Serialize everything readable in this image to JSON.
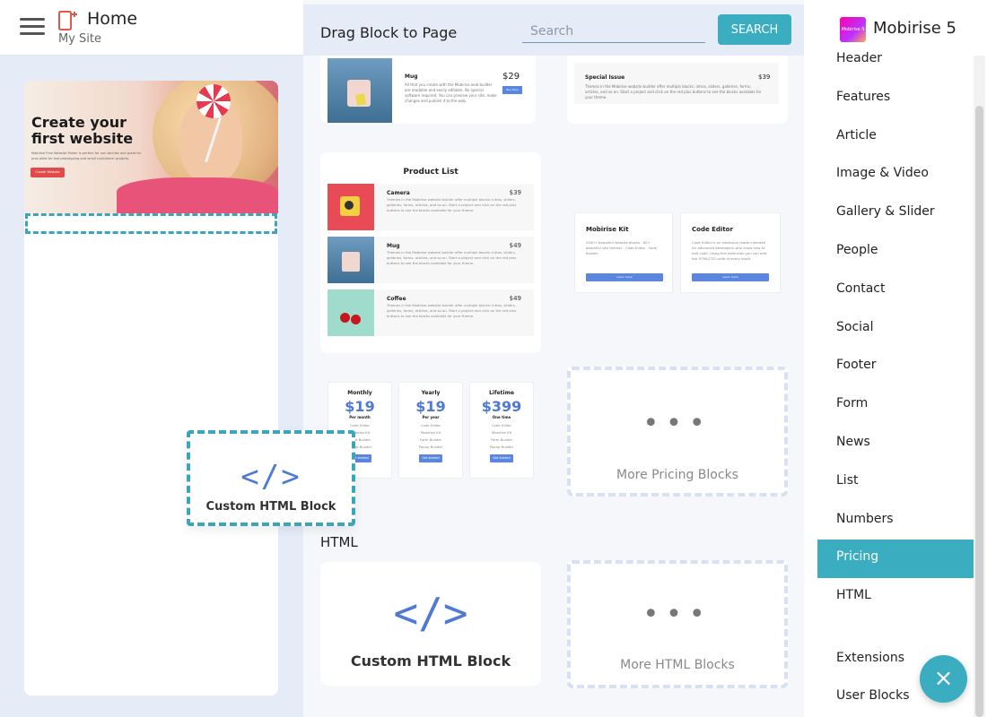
{
  "header": {
    "home_title": "Home",
    "site_subtitle": "My Site"
  },
  "preview": {
    "hero_title": "Create your first website",
    "hero_text": "Mobirise Free Website Maker is perfect for non-techies and great for pros alike for fast prototyping and small customers' projects.",
    "hero_button": "Create Website"
  },
  "drag_ghost": {
    "code_glyph": "</>",
    "label": "Custom HTML Block"
  },
  "blocks": {
    "title": "Drag Block to Page",
    "search_placeholder": "Search",
    "search_button": "SEARCH",
    "mug_card": {
      "name": "Mug",
      "price": "$29",
      "desc": "All that you create with the Mobirise web builder are readable and easily editable. No special software required. You can preview your site, make changes and publish it to the web.",
      "button": "Buy Now"
    },
    "special_issue": {
      "name": "Special Issue",
      "price": "$39",
      "desc": "Themes in the Mobirise website builder offer multiple blocks: intros, sliders, galleries, forms, articles, and so on. Start a project and click on the red plus buttons to see the blocks available for your theme."
    },
    "product_list": {
      "title": "Product List",
      "items": [
        {
          "name": "Camera",
          "price": "$39",
          "desc": "Themes in the Mobirise website builder offer multiple blocks: intros, sliders, galleries, forms, articles, and so on. Start a project and click on the red plus buttons to see the blocks available for your theme."
        },
        {
          "name": "Mug",
          "price": "$49",
          "desc": "Themes in the Mobirise website builder offer multiple blocks: intros, sliders, galleries, forms, articles, and so on. Start a project and click on the red plus buttons to see the blocks available for your theme."
        },
        {
          "name": "Coffee",
          "price": "$49",
          "desc": "Themes in the Mobirise website builder offer multiple blocks: intros, sliders, galleries, forms, articles, and so on. Start a project and click on the red plus buttons to see the blocks available for your theme."
        }
      ]
    },
    "kit_cards": [
      {
        "title": "Mobirise Kit",
        "body": "2500+ beautiful website blocks · 80+ beautiful site themes · Code Editor · Form Builder",
        "button": "Learn more"
      },
      {
        "title": "Code Editor",
        "body": "Code Editor is an extension made intended for advanced developers who know how to edit code. Using this extension you can edit the HTML/CSS code of every block.",
        "button": "Learn more"
      }
    ],
    "pricing": [
      {
        "plan": "Monthly",
        "amount": "$19",
        "period": "Per month",
        "features": [
          "Code Editor",
          "Mobirise Kit",
          "Form Builder",
          "Popup Builder"
        ],
        "button": "Get started"
      },
      {
        "plan": "Yearly",
        "amount": "$19",
        "period": "Per year",
        "features": [
          "Code Editor",
          "Mobirise Kit",
          "Form Builder",
          "Popup Builder"
        ],
        "button": "Get started"
      },
      {
        "plan": "Lifetime",
        "amount": "$399",
        "period": "One time",
        "features": [
          "Code Editor",
          "Mobirise Kit",
          "Form Builder",
          "Popup Builder"
        ],
        "button": "Get started"
      }
    ],
    "more_pricing_dots": "•••",
    "more_pricing": "More Pricing Blocks",
    "html_section": "HTML",
    "html_code_glyph": "</>",
    "custom_html": "Custom HTML Block",
    "more_html_dots": "•••",
    "more_html": "More HTML Blocks"
  },
  "sidebar": {
    "logo_text": "Mobirise 5",
    "brand": "Mobirise 5",
    "categories": [
      "Header",
      "Features",
      "Article",
      "Image & Video",
      "Gallery & Slider",
      "People",
      "Contact",
      "Social",
      "Footer",
      "Form",
      "News",
      "List",
      "Numbers",
      "Pricing",
      "HTML"
    ],
    "active": "Pricing",
    "extensions": "Extensions",
    "user_blocks": "User Blocks",
    "fab_icon": "×"
  },
  "colors": {
    "accent": "#3aadc0",
    "link_blue": "#4f79d6",
    "panel_bg": "#e5ebf7"
  }
}
